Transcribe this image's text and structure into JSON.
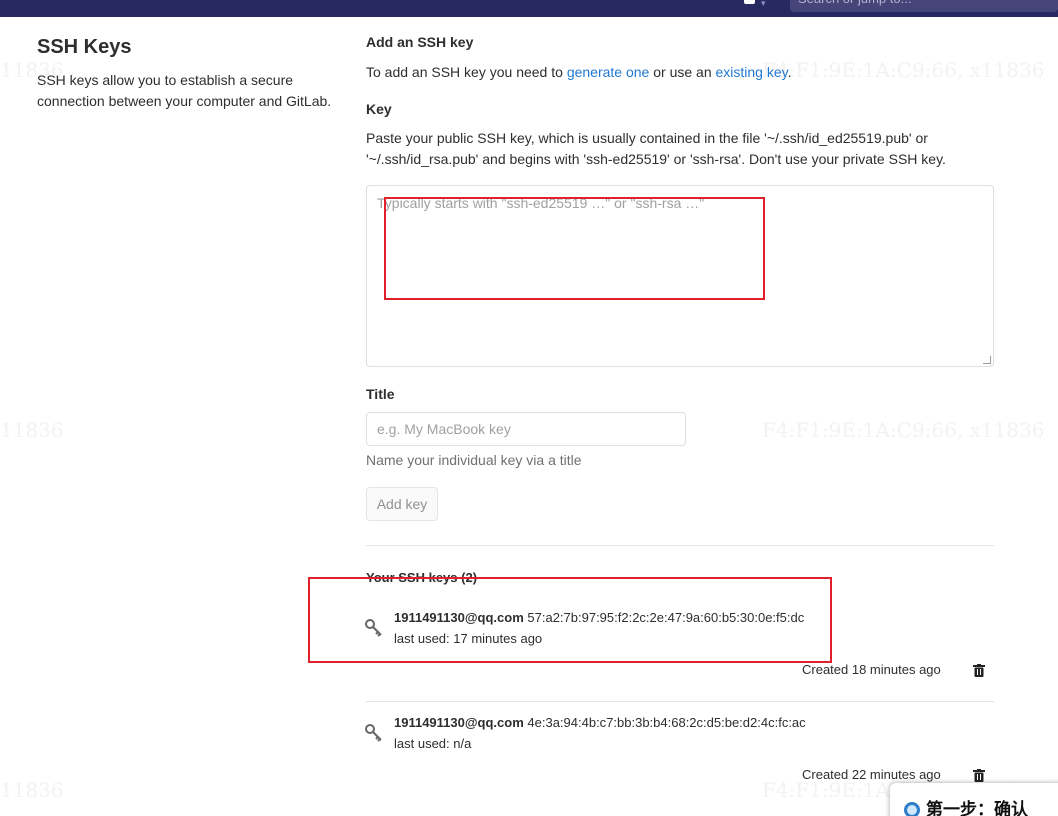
{
  "topbar": {
    "search_placeholder": "Search or jump to..."
  },
  "watermarks": {
    "left": "11836",
    "right": "F4:F1:9E:1A:C9:66, x11836"
  },
  "sidebar": {
    "title": "SSH Keys",
    "description": "SSH keys allow you to establish a secure connection between your computer and GitLab."
  },
  "add_section": {
    "title": "Add an SSH key",
    "intro_prefix": "To add an SSH key you need to ",
    "generate_link": "generate one",
    "intro_middle": " or use an ",
    "existing_link": "existing key",
    "intro_suffix": "."
  },
  "key_field": {
    "label": "Key",
    "help": "Paste your public SSH key, which is usually contained in the file '~/.ssh/id_ed25519.pub' or '~/.ssh/id_rsa.pub' and begins with 'ssh-ed25519' or 'ssh-rsa'. Don't use your private SSH key.",
    "placeholder": "Typically starts with \"ssh-ed25519 …\" or \"ssh-rsa …\""
  },
  "title_field": {
    "label": "Title",
    "placeholder": "e.g. My MacBook key",
    "help": "Name your individual key via a title"
  },
  "add_button": {
    "label": "Add key"
  },
  "keys_list": {
    "header": "Your SSH keys (2)",
    "items": [
      {
        "email": "1911491130@qq.com",
        "fingerprint": "57:a2:7b:97:95:f2:2c:2e:47:9a:60:b5:30:0e:f5:dc",
        "last_used": "last used: 17 minutes ago",
        "created": "Created 18 minutes ago"
      },
      {
        "email": "1911491130@qq.com",
        "fingerprint": "4e:3a:94:4b:c7:bb:3b:b4:68:2c:d5:be:d2:4c:fc:ac",
        "last_used": "last used: n/a",
        "created": "Created 22 minutes ago"
      }
    ]
  },
  "tip_popup": {
    "text": "第一步：确认"
  },
  "annotation_color": "#e0202a",
  "link_color": "#1f78d1"
}
